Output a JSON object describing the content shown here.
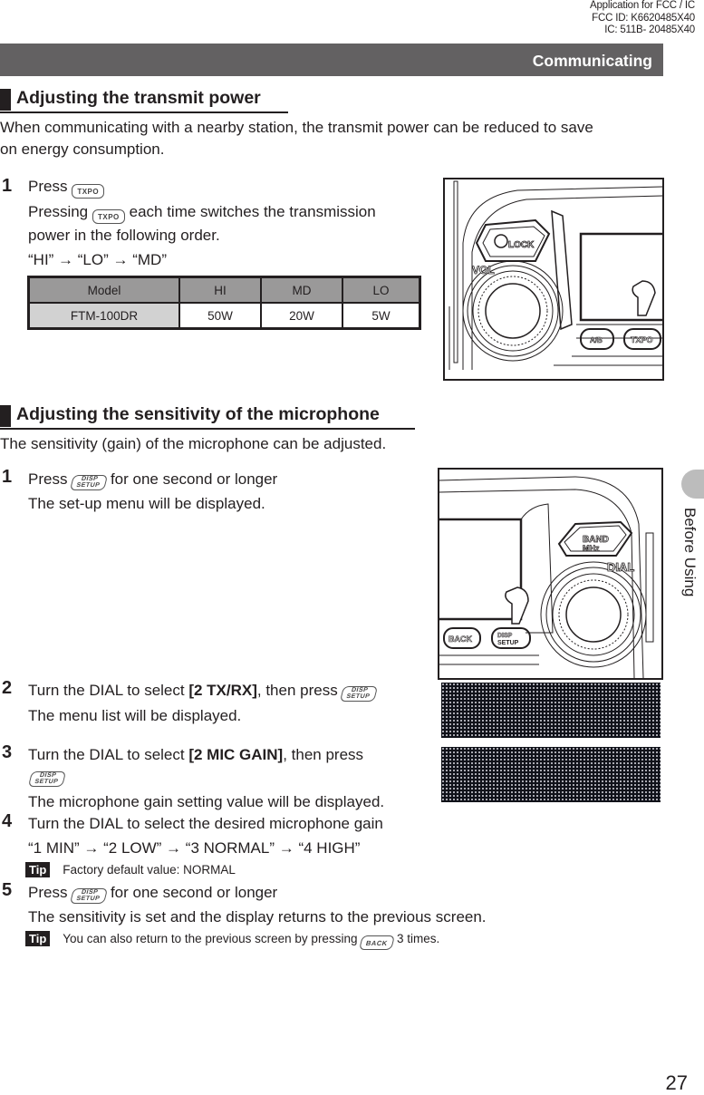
{
  "fcc_notice": {
    "line1": "Application for FCC /  IC",
    "line2": "FCC ID: K6620485X40",
    "line3": "IC: 511B- 20485X40"
  },
  "header": {
    "section": "Communicating"
  },
  "side_tab": {
    "label": "Before Using"
  },
  "page_number": "27",
  "section1": {
    "title": "Adjusting the transmit power",
    "intro_line1": "When communicating with a nearby station, the transmit power can be reduced to save",
    "intro_line2": "on energy consumption.",
    "step1": {
      "number": "1",
      "press": "Press",
      "key": "TXPO",
      "line2_a": "Pressing",
      "line2_b": "each time switches the transmission",
      "line3": "power in the following order.",
      "order": "“HI” → “LO” → “MD”"
    },
    "table": {
      "headers": [
        "Model",
        "HI",
        "MD",
        "LO"
      ],
      "rows": [
        [
          "FTM-100DR",
          "50W",
          "20W",
          "5W"
        ]
      ]
    },
    "illustration": {
      "labels": {
        "lock": "LOCK",
        "vol": "VOL",
        "ab": "A/B",
        "txpo": "TXPO"
      }
    }
  },
  "section2": {
    "title": "Adjusting the sensitivity of the microphone",
    "intro": "The sensitivity (gain) of the microphone can be adjusted.",
    "keys": {
      "disp_top": "DISP",
      "disp_bottom": "SETUP",
      "back": "BACK"
    },
    "steps": [
      {
        "number": "1",
        "text_a": "Press",
        "text_b": "for one second or longer",
        "sub": "The set-up menu will be displayed."
      },
      {
        "number": "2",
        "text_a": "Turn the DIAL to select ",
        "bold": "[2 TX/RX]",
        "text_b": ", then press",
        "sub": "The menu list will be displayed."
      },
      {
        "number": "3",
        "text_a": "Turn the DIAL to select ",
        "bold": "[2 MIC GAIN]",
        "text_b": ", then press",
        "sub": "The microphone gain setting value will be displayed."
      },
      {
        "number": "4",
        "text_a": "Turn the DIAL to select the desired microphone gain",
        "sub": "“1 MIN” → “2 LOW” → “3 NORMAL” → “4 HIGH”"
      },
      {
        "number": "5",
        "text_a": "Press",
        "text_b": "for one second or longer",
        "sub": "The sensitivity is set and the display returns to the previous screen."
      }
    ],
    "tip1": {
      "badge": "Tip",
      "text": "Factory default value: NORMAL"
    },
    "tip2": {
      "badge": "Tip",
      "text_a": "You can also return to the previous screen by pressing",
      "text_b": "3 times."
    },
    "illustration": {
      "labels": {
        "band_top": "BAND",
        "band_bottom": "MHz",
        "dial": "DIAL",
        "back": "BACK"
      }
    }
  }
}
